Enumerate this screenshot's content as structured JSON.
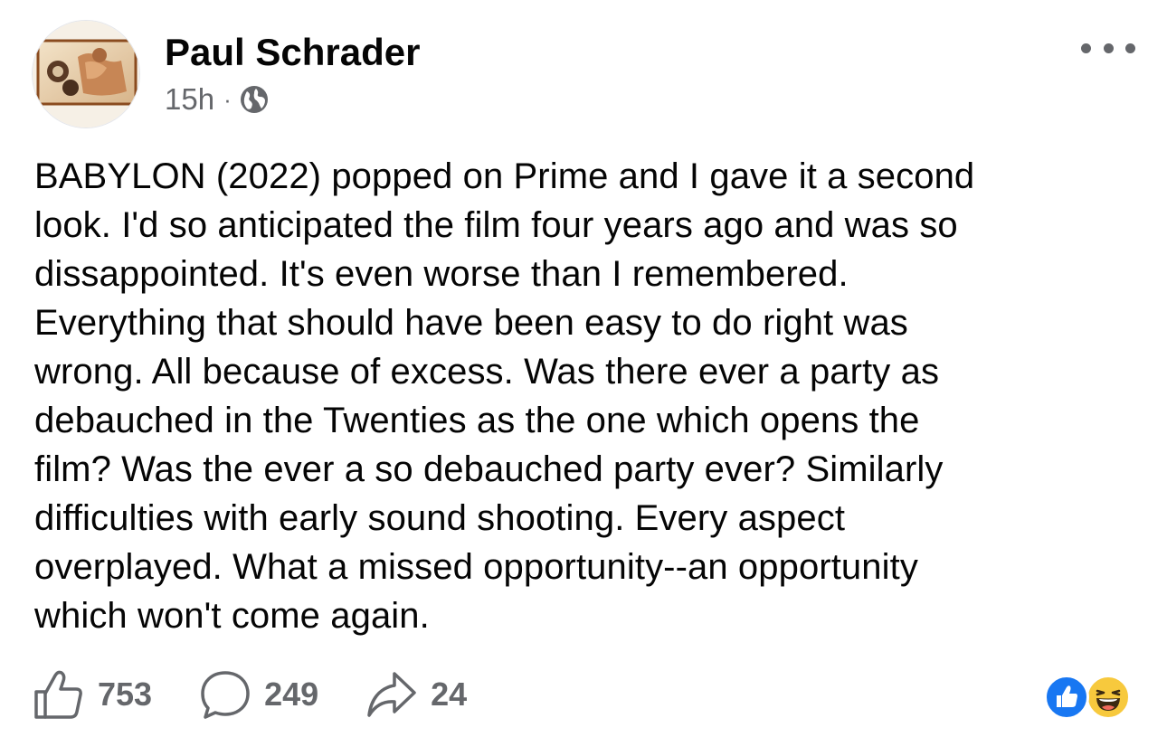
{
  "post": {
    "author": "Paul Schrader",
    "timestamp": "15h",
    "separator": "·",
    "audience_icon": "globe-icon",
    "more_icon": "more-options-icon",
    "text": "BABYLON (2022) popped on Prime and I gave it a second\nlook. I'd so anticipated the film four years ago and was so\ndissappointed. It's even worse than I remembered.\nEverything that should have been easy to do right was\nwrong. All because of excess. Was there ever a party as\ndebauched in the Twenties as the one which opens the\nfilm? Was the ever a so debauched party ever? Similarly\ndifficulties with early sound shooting. Every aspect\noverplayed. What a missed opportunity--an opportunity\nwhich won't come again."
  },
  "actions": {
    "like": {
      "icon": "thumbs-up-icon",
      "count": "753"
    },
    "comment": {
      "icon": "comment-bubble-icon",
      "count": "249"
    },
    "share": {
      "icon": "share-arrow-icon",
      "count": "24"
    }
  },
  "reactions": [
    {
      "type": "like",
      "icon": "like-reaction-icon",
      "color": "#1877f2"
    },
    {
      "type": "haha",
      "icon": "haha-reaction-icon",
      "color": "#f7c93d"
    }
  ],
  "colors": {
    "text_primary": "#050505",
    "text_secondary": "#65676b",
    "like_blue": "#1877f2",
    "haha_yellow": "#f7c93d"
  }
}
